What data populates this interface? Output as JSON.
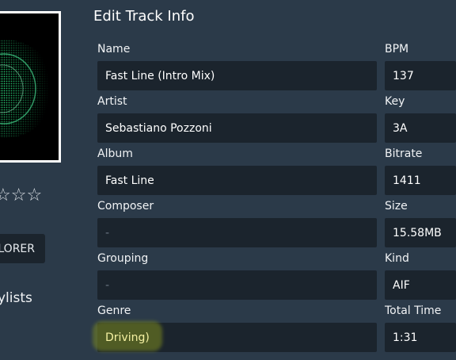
{
  "sidebar": {
    "rating_stars": "☆☆☆",
    "explorer_button_label": "LORER",
    "playlists_label": "ylists"
  },
  "panel": {
    "title": "Edit Track Info",
    "fields": {
      "name": {
        "label": "Name",
        "value": "Fast Line (Intro Mix)"
      },
      "bpm": {
        "label": "BPM",
        "value": "137"
      },
      "artist": {
        "label": "Artist",
        "value": "Sebastiano Pozzoni"
      },
      "key": {
        "label": "Key",
        "value": "3A"
      },
      "album": {
        "label": "Album",
        "value": "Fast Line"
      },
      "bitrate": {
        "label": "Bitrate",
        "value": "1411"
      },
      "composer": {
        "label": "Composer",
        "value": "-"
      },
      "size": {
        "label": "Size",
        "value": "15.58MB"
      },
      "grouping": {
        "label": "Grouping",
        "value": "-"
      },
      "kind": {
        "label": "Kind",
        "value": "AIF"
      },
      "genre": {
        "label": "Genre",
        "value": "Driving)"
      },
      "total_time": {
        "label": "Total Time",
        "value": "1:31"
      }
    }
  },
  "colors": {
    "background": "#2b3a49",
    "field_background": "#1b242d",
    "artwork_accent": "#2bd47a",
    "highlight": "#f5f1a2"
  }
}
